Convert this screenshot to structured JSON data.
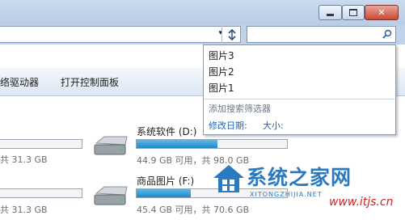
{
  "window": {
    "min_glyph": "▭",
    "max_glyph": "□",
    "close_glyph": "✕"
  },
  "address": {
    "dropdown_glyph": "▾"
  },
  "search": {
    "value": ""
  },
  "toolbar": {
    "item1": "络驱动器",
    "item2": "打开控制面板"
  },
  "dropdown": {
    "history": [
      "图片3",
      "图片2",
      "图片1"
    ],
    "filter_title": "添加搜索筛选器",
    "filters": [
      "修改日期:",
      "大小:"
    ]
  },
  "drives": [
    {
      "label": "",
      "sub": "共 31.3 GB",
      "used_fraction": 0.0
    },
    {
      "label": "系统软件 (D:)",
      "sub": "44.9 GB 可用，共 98.0 GB",
      "used_fraction": 0.54
    },
    {
      "label": "",
      "sub": "共 31.3 GB",
      "used_fraction": 0.0
    },
    {
      "label": "商品图片 (F:)",
      "sub": "45.4 GB 可用，共 70.6 GB",
      "used_fraction": 0.36
    }
  ],
  "watermark": {
    "brand": "系统之家网",
    "pinyin": "XITONGZHIJIA.NET",
    "url": "www.itjs.cn"
  },
  "colors": {
    "accent": "#1e88c8",
    "link": "#1e63b8"
  }
}
